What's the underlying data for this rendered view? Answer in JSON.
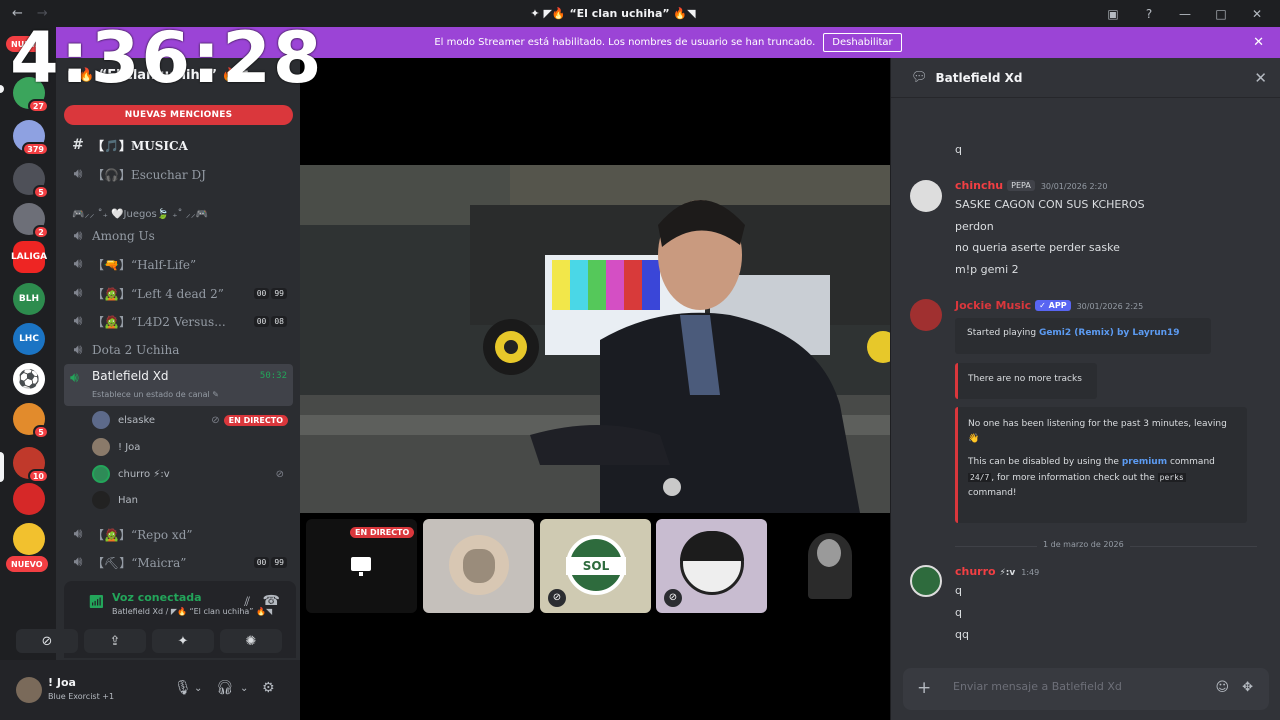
{
  "titlebar": {
    "title": "✦ ◤🔥 “El clan uchiha” 🔥◥",
    "back": "←",
    "forward": "→"
  },
  "banner": {
    "text": "El modo Streamer está habilitado. Los nombres de usuario se han truncado.",
    "button": "Deshabilitar"
  },
  "clock": "4:36:28",
  "rail": {
    "new_top": "NUEVA",
    "new_bottom": "NUEVO",
    "servers": [
      {
        "badge": "27",
        "color": "#3ba55c"
      },
      {
        "badge": "379",
        "color": "#8ea1e1"
      },
      {
        "badge": "5",
        "color": "#4e5058"
      },
      {
        "badge": "2",
        "color": "#6d6f78"
      },
      {
        "label": "LALIGA",
        "color": "#ee2523"
      },
      {
        "label": "BLH",
        "color": "#2d8c4e"
      },
      {
        "label": "LHC",
        "color": "#1b74c4"
      },
      {
        "label": "⚽",
        "color": "#ffffff"
      },
      {
        "badge": "5",
        "color": "#e28b2c"
      },
      {
        "badge": "10",
        "color": "#c0392b"
      },
      {
        "label": "",
        "color": "#d62828"
      },
      {
        "label": "",
        "color": "#f2c12e"
      }
    ]
  },
  "sidebar": {
    "server_name": "◤🔥 “El clan uchiha” 🔥◥",
    "mentions": "NUEVAS MENCIONES",
    "channels": [
      {
        "icon": "#",
        "label": "【🎵】MUSICA",
        "bold": true
      },
      {
        "icon": "🔊",
        "label": "【🎧】Escuchar DJ"
      }
    ],
    "category": "🎮⸝⸝ ˚₊ 🤍Juegos🍃 ₊˚ ⸝⸝🎮",
    "games": [
      {
        "label": "Among Us"
      },
      {
        "label": "【🔫】“Half-Life”"
      },
      {
        "label": "【🧟】“Left 4 dead 2”",
        "c1": "00",
        "c2": "99"
      },
      {
        "label": "【🧟】“L4D2 Versus...",
        "c1": "00",
        "c2": "08"
      },
      {
        "label": "Dota 2 Uchiha"
      }
    ],
    "active": {
      "label": "Batlefield Xd",
      "status": "Establece un estado de canal ✎",
      "timer": "50:32"
    },
    "voice_users": [
      {
        "name": "elsaske",
        "live": "EN DIRECTO"
      },
      {
        "name": "! Joa"
      },
      {
        "name": "churro ⚡:v"
      },
      {
        "name": "Han"
      }
    ],
    "after": [
      {
        "label": "【🧟】“Repo xd”"
      },
      {
        "label": "【⛏】“Maicra”",
        "c1": "00",
        "c2": "99"
      }
    ]
  },
  "voice": {
    "status": "Voz conectada",
    "sub": "Batlefield Xd / ◤🔥 “El clan uchiha” 🔥◥"
  },
  "user": {
    "name": "! Joa",
    "sub": "Blue Exorcist +1"
  },
  "stage": {
    "live": "EN DIRECTO",
    "sol": "SOL"
  },
  "chat": {
    "channel": "Batlefield Xd",
    "first_line": "q",
    "m1": {
      "author": "chinchu",
      "tag": "PEPA",
      "time": "30/01/2026 2:20",
      "lines": [
        "SASKE CAGON CON SUS KCHEROS",
        "perdon",
        "no queria aserte perder saske",
        "m!p gemi 2"
      ]
    },
    "m2": {
      "author": "Jockie Music",
      "app": "✓ APP",
      "time": "30/01/2026 2:25",
      "embed1_prefix": "Started playing ",
      "embed1_link": "Gemi2 (Remix) by Layrun19",
      "embed2": "There are no more tracks",
      "embed3_a": "No one has been listening for the past 3 minutes, leaving 👋",
      "embed3_b": "This can be disabled by using the ",
      "embed3_premium": "premium",
      "embed3_c": " command",
      "embed3_d": "24/7",
      "embed3_e": ", for more information check out the ",
      "embed3_perks": "perks",
      "embed3_f": "command!"
    },
    "date_sep": "1 de marzo de 2026",
    "m3": {
      "author": "churro",
      "suffix": "⚡:v",
      "time": "1:49",
      "lines": [
        "q",
        "q",
        "qq"
      ]
    },
    "composer_placeholder": "Enviar mensaje a Batlefield Xd"
  }
}
